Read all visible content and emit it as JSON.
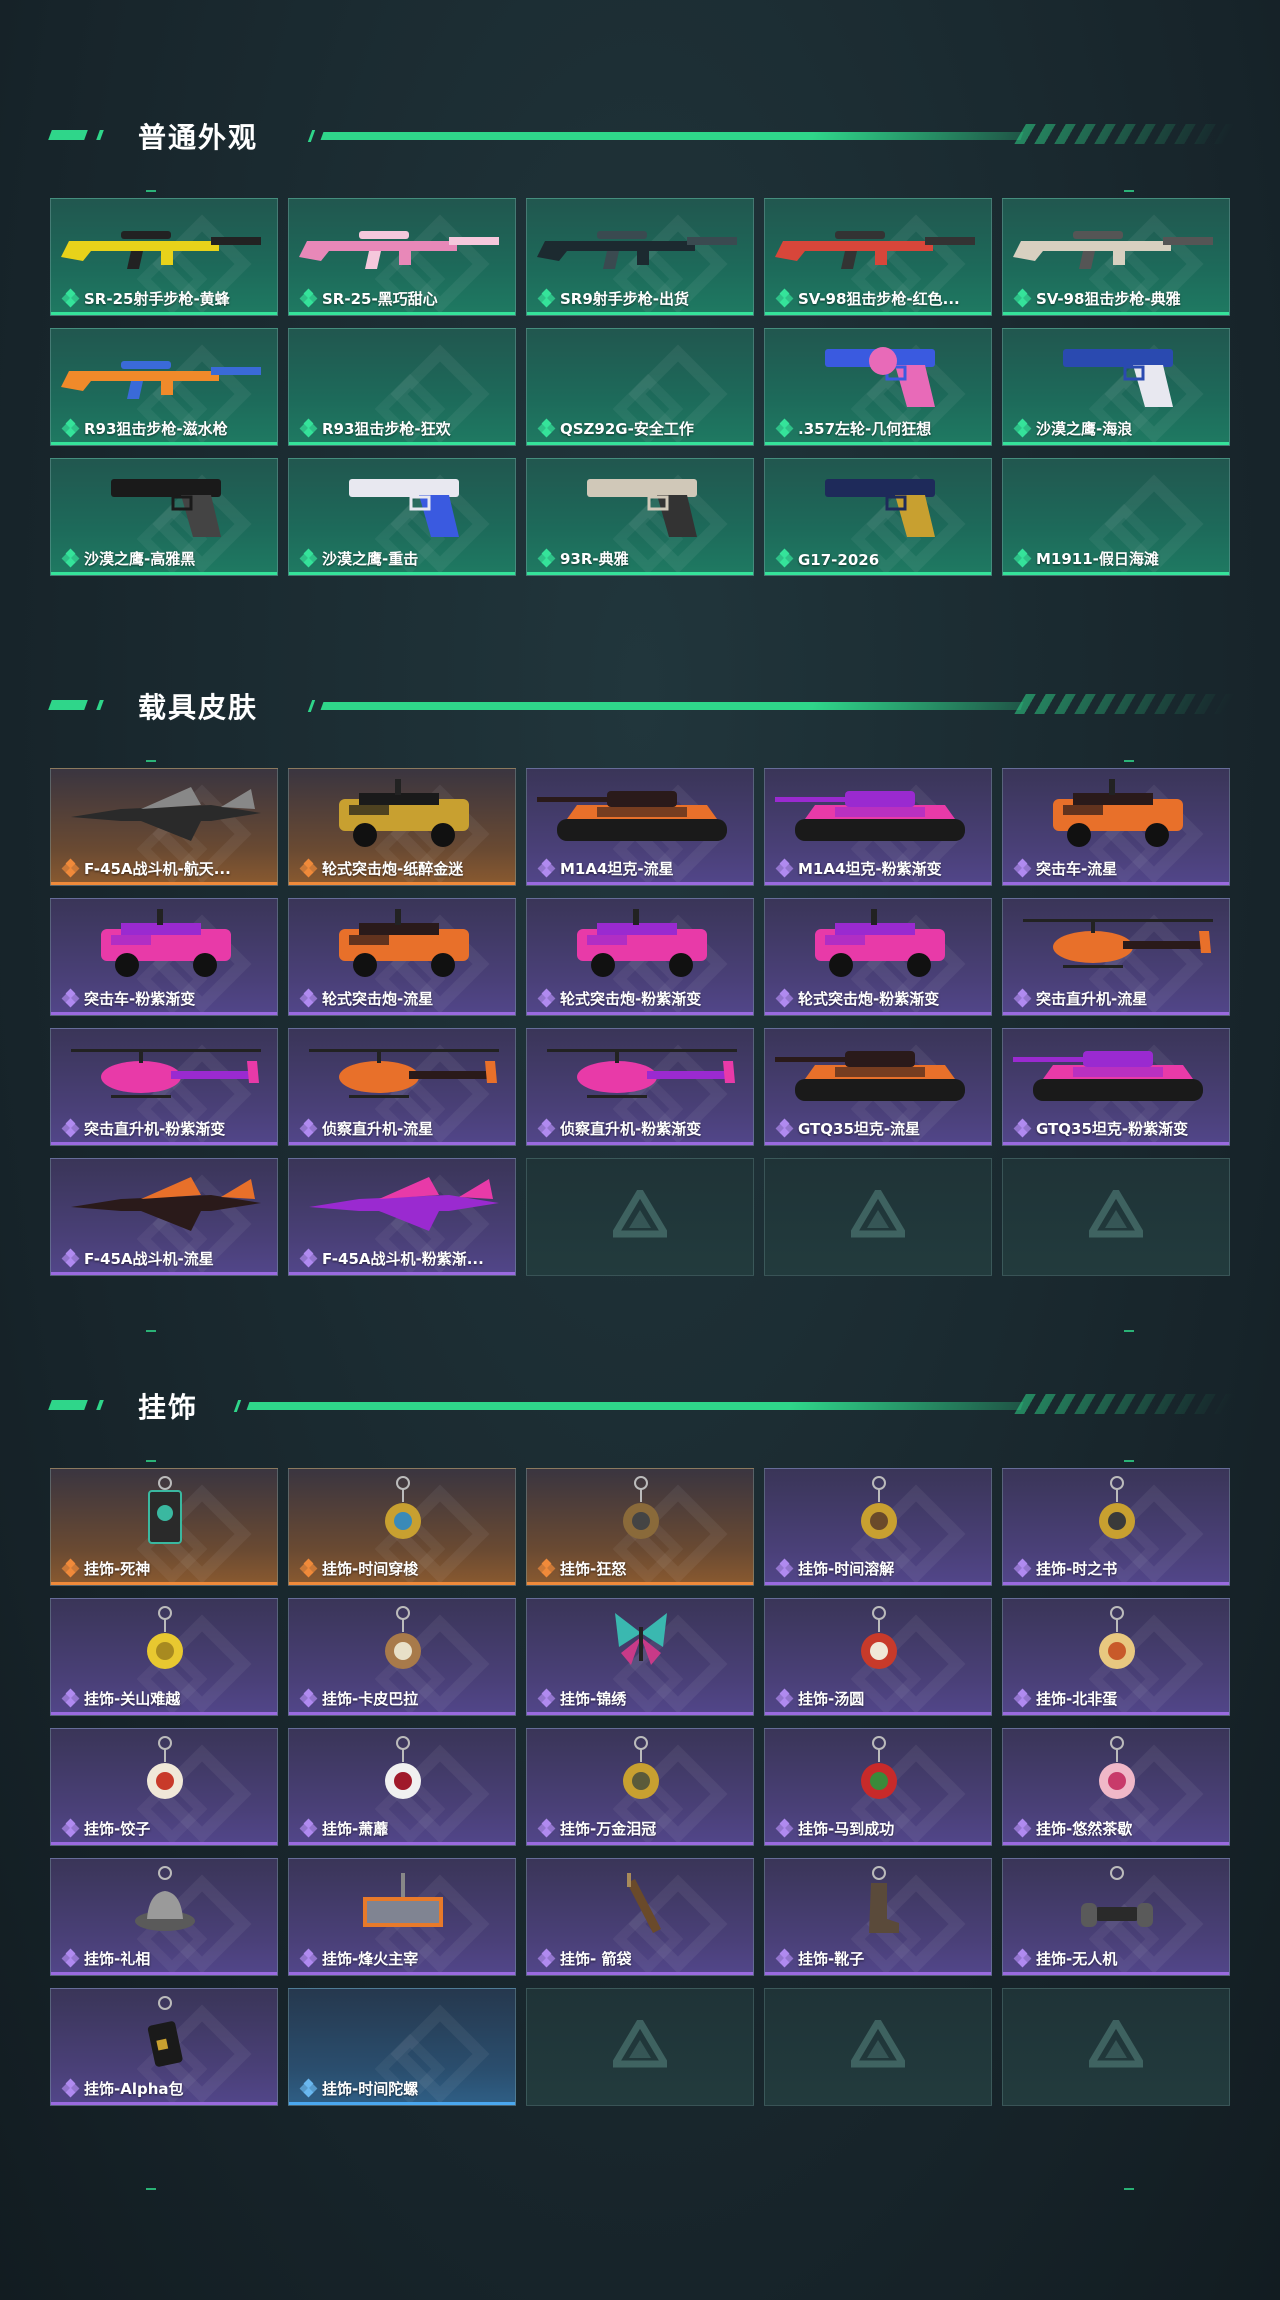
{
  "sections": [
    {
      "title": "普通外观",
      "items": [
        {
          "name": "SR-25射手步枪-黄蜂",
          "rarity": "green",
          "icon": "rifle-icon",
          "c1": "#e8d21a",
          "c2": "#222"
        },
        {
          "name": "SR-25-黑巧甜心",
          "rarity": "green",
          "icon": "rifle-icon",
          "c1": "#e888b8",
          "c2": "#f5c8dc"
        },
        {
          "name": "SR9射手步枪-出货",
          "rarity": "green",
          "icon": "rifle-icon",
          "c1": "#1c2a30",
          "c2": "#3a4a50"
        },
        {
          "name": "SV-98狙击步枪-红色...",
          "rarity": "green",
          "icon": "rifle-icon",
          "c1": "#d8463a",
          "c2": "#333"
        },
        {
          "name": "SV-98狙击步枪-典雅",
          "rarity": "green",
          "icon": "rifle-icon",
          "c1": "#d8d0c0",
          "c2": "#555"
        },
        {
          "name": "R93狙击步枪-滋水枪",
          "rarity": "green",
          "icon": "rifle-icon",
          "c1": "#f08a2a",
          "c2": "#3a6ad8"
        },
        {
          "name": "R93狙击步枪-狂欢",
          "rarity": "green",
          "icon": "",
          "c1": "",
          "c2": ""
        },
        {
          "name": "QSZ92G-安全工作",
          "rarity": "green",
          "icon": "",
          "c1": "",
          "c2": ""
        },
        {
          "name": ".357左轮-几何狂想",
          "rarity": "green",
          "icon": "revolver-icon",
          "c1": "#3a5ae0",
          "c2": "#e86ab8"
        },
        {
          "name": "沙漠之鹰-海浪",
          "rarity": "green",
          "icon": "pistol-icon",
          "c1": "#2a4ab0",
          "c2": "#e8e8f0"
        },
        {
          "name": "沙漠之鹰-高雅黑",
          "rarity": "green",
          "icon": "pistol-icon",
          "c1": "#1a1a1a",
          "c2": "#444"
        },
        {
          "name": "沙漠之鹰-重击",
          "rarity": "green",
          "icon": "pistol-icon",
          "c1": "#e8e8f0",
          "c2": "#3a5ae0"
        },
        {
          "name": "93R-典雅",
          "rarity": "green",
          "icon": "pistol-icon",
          "c1": "#d0c8b8",
          "c2": "#333"
        },
        {
          "name": "G17-2026",
          "rarity": "green",
          "icon": "pistol-icon",
          "c1": "#1e2a5a",
          "c2": "#c8a030"
        },
        {
          "name": "M1911-假日海滩",
          "rarity": "green",
          "icon": "",
          "c1": "",
          "c2": ""
        }
      ]
    },
    {
      "title": "载具皮肤",
      "items": [
        {
          "name": "F-45A战斗机-航天...",
          "rarity": "orange",
          "icon": "jet-icon",
          "c1": "#2a2a2a",
          "c2": "#888"
        },
        {
          "name": "轮式突击炮-纸醉金迷",
          "rarity": "orange",
          "icon": "armored-car-icon",
          "c1": "#1a1a1a",
          "c2": "#c8a030"
        },
        {
          "name": "M1A4坦克-流星",
          "rarity": "purple",
          "icon": "tank-icon",
          "c1": "#2a1a1a",
          "c2": "#e8702a"
        },
        {
          "name": "M1A4坦克-粉紫渐变",
          "rarity": "purple",
          "icon": "tank-icon",
          "c1": "#9a2ad0",
          "c2": "#e83aa8"
        },
        {
          "name": "突击车-流星",
          "rarity": "purple",
          "icon": "armored-car-icon",
          "c1": "#2a1a1a",
          "c2": "#e8702a"
        },
        {
          "name": "突击车-粉紫渐变",
          "rarity": "purple",
          "icon": "armored-car-icon",
          "c1": "#9a2ad0",
          "c2": "#e83aa8"
        },
        {
          "name": "轮式突击炮-流星",
          "rarity": "purple",
          "icon": "armored-car-icon",
          "c1": "#2a1a1a",
          "c2": "#e8702a"
        },
        {
          "name": "轮式突击炮-粉紫渐变",
          "rarity": "purple",
          "icon": "armored-car-icon",
          "c1": "#9a2ad0",
          "c2": "#e83aa8"
        },
        {
          "name": "轮式突击炮-粉紫渐变",
          "rarity": "purple",
          "icon": "armored-car-icon",
          "c1": "#9a2ad0",
          "c2": "#e83aa8"
        },
        {
          "name": "突击直升机-流星",
          "rarity": "purple",
          "icon": "helicopter-icon",
          "c1": "#2a1a1a",
          "c2": "#e8702a"
        },
        {
          "name": "突击直升机-粉紫渐变",
          "rarity": "purple",
          "icon": "helicopter-icon",
          "c1": "#9a2ad0",
          "c2": "#e83aa8"
        },
        {
          "name": "侦察直升机-流星",
          "rarity": "purple",
          "icon": "helicopter-icon",
          "c1": "#2a1a1a",
          "c2": "#e8702a"
        },
        {
          "name": "侦察直升机-粉紫渐变",
          "rarity": "purple",
          "icon": "helicopter-icon",
          "c1": "#9a2ad0",
          "c2": "#e83aa8"
        },
        {
          "name": "GTQ35坦克-流星",
          "rarity": "purple",
          "icon": "tank-icon",
          "c1": "#2a1a1a",
          "c2": "#e8702a"
        },
        {
          "name": "GTQ35坦克-粉紫渐变",
          "rarity": "purple",
          "icon": "tank-icon",
          "c1": "#9a2ad0",
          "c2": "#e83aa8"
        },
        {
          "name": "F-45A战斗机-流星",
          "rarity": "purple",
          "icon": "jet-icon",
          "c1": "#2a1a1a",
          "c2": "#e8702a"
        },
        {
          "name": "F-45A战斗机-粉紫渐...",
          "rarity": "purple",
          "icon": "jet-icon",
          "c1": "#9a2ad0",
          "c2": "#e83aa8"
        },
        {
          "name": "",
          "rarity": "empty",
          "icon": "logo-icon",
          "c1": "",
          "c2": ""
        },
        {
          "name": "",
          "rarity": "empty",
          "icon": "logo-icon",
          "c1": "",
          "c2": ""
        },
        {
          "name": "",
          "rarity": "empty",
          "icon": "logo-icon",
          "c1": "",
          "c2": ""
        }
      ]
    },
    {
      "title": "挂饰",
      "items": [
        {
          "name": "挂饰-死神",
          "rarity": "orange",
          "icon": "card-pendant-icon",
          "c1": "#2a2a2a",
          "c2": "#3ab8a0"
        },
        {
          "name": "挂饰-时间穿梭",
          "rarity": "orange",
          "icon": "pendant-icon",
          "c1": "#c8a030",
          "c2": "#3a8ab8"
        },
        {
          "name": "挂饰-狂怒",
          "rarity": "orange",
          "icon": "pendant-icon",
          "c1": "#8a6a3a",
          "c2": "#444"
        },
        {
          "name": "挂饰-时间溶解",
          "rarity": "purple",
          "icon": "pendant-icon",
          "c1": "#c8a030",
          "c2": "#6a4a2a"
        },
        {
          "name": "挂饰-时之书",
          "rarity": "purple",
          "icon": "pendant-icon",
          "c1": "#c8a030",
          "c2": "#3a3a3a"
        },
        {
          "name": "挂饰-关山难越",
          "rarity": "purple",
          "icon": "pendant-icon",
          "c1": "#e8c830",
          "c2": "#a88a20"
        },
        {
          "name": "挂饰-卡皮巴拉",
          "rarity": "purple",
          "icon": "pendant-icon",
          "c1": "#a87a4a",
          "c2": "#e8e0c8"
        },
        {
          "name": "挂饰-锦绣",
          "rarity": "purple",
          "icon": "butterfly-icon",
          "c1": "#3ab8b0",
          "c2": "#c83a88"
        },
        {
          "name": "挂饰-汤圆",
          "rarity": "purple",
          "icon": "pendant-icon",
          "c1": "#c83a2a",
          "c2": "#f0e8d8"
        },
        {
          "name": "挂饰-北非蛋",
          "rarity": "purple",
          "icon": "pendant-icon",
          "c1": "#e8c880",
          "c2": "#c85a2a"
        },
        {
          "name": "挂饰-饺子",
          "rarity": "purple",
          "icon": "pendant-icon",
          "c1": "#f0e8d8",
          "c2": "#c83a2a"
        },
        {
          "name": "挂饰-萧蘼",
          "rarity": "purple",
          "icon": "pendant-icon",
          "c1": "#f0f0f0",
          "c2": "#a01a2a"
        },
        {
          "name": "挂饰-万金泪冠",
          "rarity": "purple",
          "icon": "pendant-icon",
          "c1": "#c8a030",
          "c2": "#5a5a3a"
        },
        {
          "name": "挂饰-马到成功",
          "rarity": "purple",
          "icon": "pendant-icon",
          "c1": "#c82a2a",
          "c2": "#3a8a3a"
        },
        {
          "name": "挂饰-悠然茶歇",
          "rarity": "purple",
          "icon": "pendant-icon",
          "c1": "#f0b8c8",
          "c2": "#c83a6a"
        },
        {
          "name": "挂饰-礼相",
          "rarity": "purple",
          "icon": "hat-icon",
          "c1": "#9a9a9a",
          "c2": "#5a5a5a"
        },
        {
          "name": "挂饰-烽火主宰",
          "rarity": "purple",
          "icon": "banner-icon",
          "c1": "#e87a2a",
          "c2": "#3a8ad8"
        },
        {
          "name": "挂饰- 箭袋",
          "rarity": "purple",
          "icon": "quiver-icon",
          "c1": "#6a4a2a",
          "c2": "#a88a5a"
        },
        {
          "name": "挂饰-靴子",
          "rarity": "purple",
          "icon": "boot-icon",
          "c1": "#5a4a3a",
          "c2": "#8a7a6a"
        },
        {
          "name": "挂饰-无人机",
          "rarity": "purple",
          "icon": "drone-icon",
          "c1": "#2a2a2a",
          "c2": "#5a5a5a"
        },
        {
          "name": "挂饰-Alpha包",
          "rarity": "purple",
          "icon": "bag-icon",
          "c1": "#1a1a1a",
          "c2": "#c8a030"
        },
        {
          "name": "挂饰-时间陀螺",
          "rarity": "blue",
          "icon": "",
          "c1": "",
          "c2": ""
        },
        {
          "name": "",
          "rarity": "empty",
          "icon": "logo-icon",
          "c1": "",
          "c2": ""
        },
        {
          "name": "",
          "rarity": "empty",
          "icon": "logo-icon",
          "c1": "",
          "c2": ""
        },
        {
          "name": "",
          "rarity": "empty",
          "icon": "logo-icon",
          "c1": "",
          "c2": ""
        }
      ]
    }
  ],
  "colors": {
    "accent": "#2fd68a",
    "green": "#35e39a",
    "purple": "#9a6ae0",
    "orange": "#f08a3a",
    "blue": "#4aa8f0"
  }
}
